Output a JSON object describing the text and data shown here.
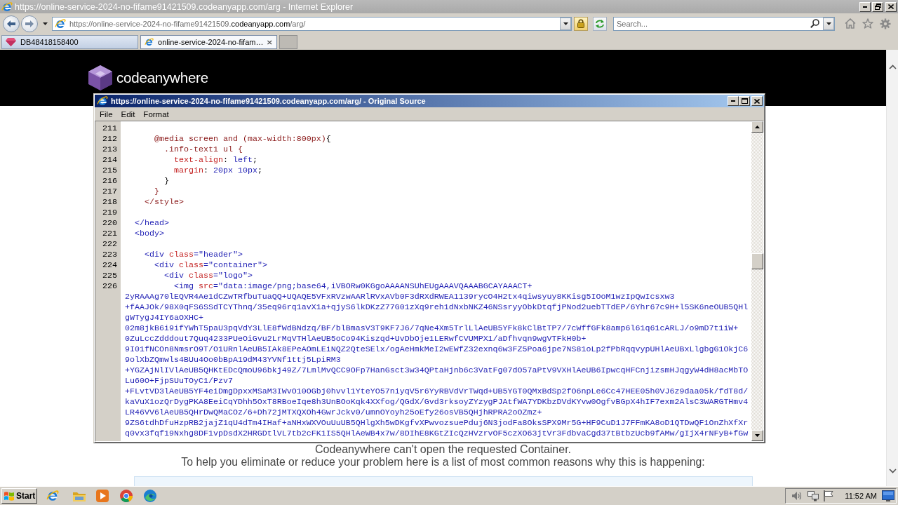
{
  "browser": {
    "title": "https://online-service-2024-no-fifame91421509.codeanyapp.com/arg - Internet Explorer",
    "address": {
      "before_domain": "https://online-service-2024-no-fifame91421509.",
      "domain": "codeanyapp.com",
      "after_domain": "/arg/"
    },
    "search": {
      "placeholder": "Search..."
    },
    "tabs": [
      {
        "label": "DB48418158400",
        "selected": false
      },
      {
        "label": "online-service-2024-no-fifam…",
        "selected": true
      }
    ]
  },
  "page": {
    "logo": "codeanywhere",
    "message": "Codeanywhere can't open the requested Container.",
    "intro": "To help you eliminate or reduce your problem here is a list of most common reasons why this is happening:"
  },
  "source_window": {
    "title": "https://online-service-2024-no-fifame91421509.codeanyapp.com/arg/ - Original Source",
    "menu": [
      "File",
      "Edit",
      "Format"
    ],
    "lines": [
      {
        "number": "211"
      },
      {
        "number": "212",
        "tokens": [
          {
            "kind": "selector",
            "text": "      @media screen and (max-width:800px)"
          },
          {
            "kind": "text",
            "text": "{"
          }
        ]
      },
      {
        "number": "213",
        "tokens": [
          {
            "kind": "selector",
            "text": "        .info-text1 ul {"
          }
        ]
      },
      {
        "number": "214",
        "tokens": [
          {
            "kind": "property",
            "text": "          text-align"
          },
          {
            "kind": "text",
            "text": ": "
          },
          {
            "kind": "value",
            "text": "left"
          },
          {
            "kind": "text",
            "text": ";"
          }
        ]
      },
      {
        "number": "215",
        "tokens": [
          {
            "kind": "property",
            "text": "          margin"
          },
          {
            "kind": "text",
            "text": ": "
          },
          {
            "kind": "value",
            "text": "20px 10px"
          },
          {
            "kind": "text",
            "text": ";"
          }
        ]
      },
      {
        "number": "216",
        "tokens": [
          {
            "kind": "text",
            "text": "        }"
          }
        ]
      },
      {
        "number": "217",
        "tokens": [
          {
            "kind": "selector",
            "text": "      }"
          }
        ]
      },
      {
        "number": "218",
        "tokens": [
          {
            "kind": "selector",
            "text": "    </style>"
          }
        ]
      },
      {
        "number": "219"
      },
      {
        "number": "220",
        "tokens": [
          {
            "kind": "tag",
            "text": "  </head>"
          }
        ]
      },
      {
        "number": "221",
        "tokens": [
          {
            "kind": "tag",
            "text": "  <body>"
          }
        ]
      },
      {
        "number": "222"
      },
      {
        "number": "223",
        "tokens": [
          {
            "kind": "tag",
            "text": "    <div "
          },
          {
            "kind": "attr",
            "text": "class"
          },
          {
            "kind": "value",
            "text": "=\"header\">"
          }
        ]
      },
      {
        "number": "224",
        "tokens": [
          {
            "kind": "tag",
            "text": "      <div "
          },
          {
            "kind": "attr",
            "text": "class"
          },
          {
            "kind": "value",
            "text": "=\"container\">"
          }
        ]
      },
      {
        "number": "225",
        "tokens": [
          {
            "kind": "tag",
            "text": "        <div "
          },
          {
            "kind": "attr",
            "text": "class"
          },
          {
            "kind": "value",
            "text": "=\"logo\">"
          }
        ]
      },
      {
        "number": "226",
        "tokens": [
          {
            "kind": "tag",
            "text": "          <img "
          },
          {
            "kind": "attr",
            "text": "src"
          },
          {
            "kind": "value",
            "text": "=\"data:image/png;base64,iVBORw0KGgoAAAANSUhEUgAAAVQAAABGCAYAAACT+"
          }
        ],
        "wrapped": [
          "2yRAAAg70lEQVR4Ae1dCZwTRfbuTuaQQ+UQAQE5VFxRVzwAARlRVxAVb0F3dRXdRWEA1139rycO4H2tx4qiwsyuy8KKisg5IOoM1wzIpQwIcsxw3",
          "+fAAJOk/98X0qFS6SSdTCYThnq/35eq96rq1avX1a+qjyS6lkDKzZ77G01zXq9reh1dNxbNKZ46NSsryyObkDtqfjPNod2uebTTdEP/6Yhr67c9H+l5SK6neOUB5QHl",
          "gWTygJ4IY6aOXHC+",
          "02m8jkB6i9ifYWhT5paU3pqVdY3LlE8fWdBNdzq/BF/blBmasV3T9KF7J6/7qNe4Xm5TrlLlAeUB5YFk8kClBtTP7/7cWffGFk8amp6l61q61cARLJ/o9mD7t1iW+",
          "0ZuLccZdddout7Quq4233PUeOiGvu2LrMqVTHlAeUB5oCo94Kiszqd+UvDbOje1LERwfCVUMPX1/aDfhvqn9wgVTFkH0b+",
          "9I01fNCOn8NmsrO9T/O1URnlAeUB5IAk8EPeAOmLEiNQZ2QteSElx/ogAeHmkMeI2wEWfZ32exnq6w3FZ5Poa6jpe7NS81oLp2fPbRqqvypUHlAeUBxLlgbgG1OkjC6",
          "9olXbZQmwls4BUu4Oo0bBpA19dM43YVNf1ttj5LpiRM3",
          "+YGZAjNlIVlAeUB5QHKtEDcQmoU96bkj49Z/7LmlMvQCC9OFp7HanGsct3w34QPtaHjnb6c3VatFg07dO57aPtV9VXHlAeUB6IpwcqHFCnjizsmHJqgyW4dH8acMbTO",
          "Lu60O+FjpSUuTOyC1/Pzv7",
          "+FLvtVD3lAeUB5YF4eiDmgDpxxMSaM3IWvO10OGbj0hvvl1YteYO57niyqV5r6YyRBVdVrTWqd+UB5YGT0QMxBdSp2fO6npLe6Cc47HEE05h0VJ6z9daa05k/fdT8d/",
          "kaVuX1ozQrDygPKA8EeiCqYDhh5OxT8RBoeIqe8h3UnBOoKqk4XXfog/QGdX/Gvd3rksoyZYzygPJAtfWA7YDKbzDVdKYvw0OgfvBGpX4hIF7exm2AlsC3WARGTHmv4",
          "LR46VV6lAeUB5QHrDwQMaCOz/6+Dh72jMTXQXOh4GwrJckv0/umnOYoyh25oEfy26osVB5QHjhRPRA2oOZmz+",
          "9ZS6tdhDfuHzpRB2jajZ1qU4dTm4IHaf+aNHxWXVOuUuUB5QHlgXh5wDKgfvXPwvozsuePduj6N3jodFa8OksSPX9Mr5G+HF9CuD1J7FFmKA8oD1QTDwQF1OnZhXfXr",
          "q0vx3fqf19Nxhg8DF1vpDsdX2HRGDtlVL7tb2cFK1IS5QHlAeWB4x7w/8DIhE8KGtZIcQzHVzrvOF5czXO63jtVr3FdbvaCgd37tBtbzUcb9fAMw/gIjX4rNFyB+fGw"
        ]
      }
    ]
  },
  "taskbar": {
    "start": "Start",
    "clock": "11:52 AM"
  }
}
